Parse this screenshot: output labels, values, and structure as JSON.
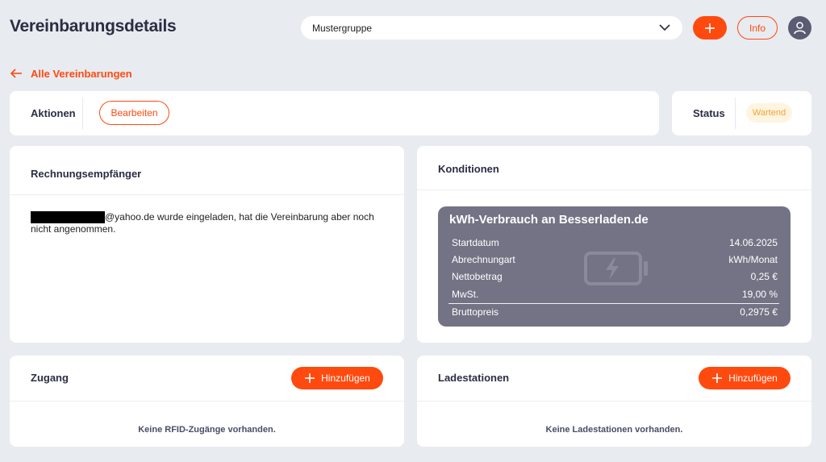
{
  "header": {
    "title": "Vereinbarungsdetails",
    "group_select_value": "Mustergruppe",
    "info_label": "Info"
  },
  "nav": {
    "back_label": "Alle Vereinbarungen"
  },
  "actions_card": {
    "label": "Aktionen",
    "edit_label": "Bearbeiten"
  },
  "status_card": {
    "label": "Status",
    "status_value": "Wartend"
  },
  "recipient_card": {
    "title": "Rechnungsempfänger",
    "invite_text": "@yahoo.de wurde eingeladen, hat die Vereinbarung aber noch nicht angenommen."
  },
  "conditions_card": {
    "title": "Konditionen",
    "box_title": "kWh-Verbrauch an Besserladen.de",
    "rows": [
      {
        "label": "Startdatum",
        "value": "14.06.2025"
      },
      {
        "label": "Abrechnungart",
        "value": "kWh/Monat"
      },
      {
        "label": "Nettobetrag",
        "value": "0,25 €"
      },
      {
        "label": "MwSt.",
        "value": "19,00 %"
      },
      {
        "label": "Bruttopreis",
        "value": "0,2975 €"
      }
    ]
  },
  "access_card": {
    "title": "Zugang",
    "add_label": "Hinzufügen",
    "empty_text": "Keine RFID-Zugänge vorhanden."
  },
  "stations_card": {
    "title": "Ladestationen",
    "add_label": "Hinzufügen",
    "empty_text": "Keine Ladestationen vorhanden."
  },
  "colors": {
    "accent": "#ff4a0f",
    "background": "#e8ebf0",
    "conditions_box": "#737385",
    "status_badge_bg": "#fff4df",
    "status_badge_text": "#f0a43a"
  }
}
